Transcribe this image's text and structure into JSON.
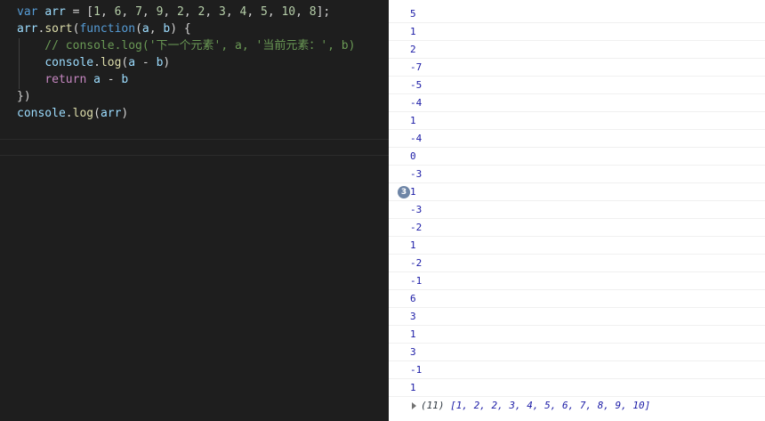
{
  "editor": {
    "lines": [
      [
        {
          "t": "var",
          "c": "kw"
        },
        {
          "t": " ",
          "c": "plain"
        },
        {
          "t": "arr",
          "c": "var"
        },
        {
          "t": " = [",
          "c": "plain"
        },
        {
          "t": "1",
          "c": "num"
        },
        {
          "t": ", ",
          "c": "plain"
        },
        {
          "t": "6",
          "c": "num"
        },
        {
          "t": ", ",
          "c": "plain"
        },
        {
          "t": "7",
          "c": "num"
        },
        {
          "t": ", ",
          "c": "plain"
        },
        {
          "t": "9",
          "c": "num"
        },
        {
          "t": ", ",
          "c": "plain"
        },
        {
          "t": "2",
          "c": "num"
        },
        {
          "t": ", ",
          "c": "plain"
        },
        {
          "t": "2",
          "c": "num"
        },
        {
          "t": ", ",
          "c": "plain"
        },
        {
          "t": "3",
          "c": "num"
        },
        {
          "t": ", ",
          "c": "plain"
        },
        {
          "t": "4",
          "c": "num"
        },
        {
          "t": ", ",
          "c": "plain"
        },
        {
          "t": "5",
          "c": "num"
        },
        {
          "t": ", ",
          "c": "plain"
        },
        {
          "t": "10",
          "c": "num"
        },
        {
          "t": ", ",
          "c": "plain"
        },
        {
          "t": "8",
          "c": "num"
        },
        {
          "t": "];",
          "c": "plain"
        }
      ],
      [
        {
          "t": "arr",
          "c": "var"
        },
        {
          "t": ".",
          "c": "plain"
        },
        {
          "t": "sort",
          "c": "fn"
        },
        {
          "t": "(",
          "c": "plain"
        },
        {
          "t": "function",
          "c": "kw"
        },
        {
          "t": "(",
          "c": "plain"
        },
        {
          "t": "a",
          "c": "var"
        },
        {
          "t": ", ",
          "c": "plain"
        },
        {
          "t": "b",
          "c": "var"
        },
        {
          "t": ") {",
          "c": "plain"
        }
      ],
      [
        {
          "t": "    // console.log('下一个元素', a, '当前元素：', b)",
          "c": "cmt"
        }
      ],
      [
        {
          "t": "    ",
          "c": "plain"
        },
        {
          "t": "console",
          "c": "var"
        },
        {
          "t": ".",
          "c": "plain"
        },
        {
          "t": "log",
          "c": "fn"
        },
        {
          "t": "(",
          "c": "plain"
        },
        {
          "t": "a",
          "c": "var"
        },
        {
          "t": " - ",
          "c": "plain"
        },
        {
          "t": "b",
          "c": "var"
        },
        {
          "t": ")",
          "c": "plain"
        }
      ],
      [
        {
          "t": "    ",
          "c": "plain"
        },
        {
          "t": "return",
          "c": "ctrl"
        },
        {
          "t": " ",
          "c": "plain"
        },
        {
          "t": "a",
          "c": "var"
        },
        {
          "t": " - ",
          "c": "plain"
        },
        {
          "t": "b",
          "c": "var"
        }
      ],
      [
        {
          "t": "})",
          "c": "plain"
        }
      ],
      [
        {
          "t": "console",
          "c": "var"
        },
        {
          "t": ".",
          "c": "plain"
        },
        {
          "t": "log",
          "c": "fn"
        },
        {
          "t": "(",
          "c": "plain"
        },
        {
          "t": "arr",
          "c": "var"
        },
        {
          "t": ")",
          "c": "plain"
        }
      ]
    ]
  },
  "console": {
    "entries": [
      {
        "value": "5"
      },
      {
        "value": "1"
      },
      {
        "value": "2"
      },
      {
        "value": "-7"
      },
      {
        "value": "-5"
      },
      {
        "value": "-4"
      },
      {
        "value": "1"
      },
      {
        "value": "-4"
      },
      {
        "value": "0"
      },
      {
        "value": "-3"
      },
      {
        "value": "1",
        "badge": "3"
      },
      {
        "value": "-3"
      },
      {
        "value": "-2"
      },
      {
        "value": "1"
      },
      {
        "value": "-2"
      },
      {
        "value": "-1"
      },
      {
        "value": "6"
      },
      {
        "value": "3"
      },
      {
        "value": "1"
      },
      {
        "value": "3"
      },
      {
        "value": "-1"
      },
      {
        "value": "1"
      }
    ],
    "array_count": "(11)",
    "array_values": "[1, 2, 2, 3, 4, 5, 6, 7, 8, 9, 10]"
  },
  "colors": {
    "keyword": "#569cd6",
    "control": "#c586c0",
    "variable": "#9cdcfe",
    "number": "#b5cea8",
    "function": "#dcdcaa",
    "comment": "#6a9955",
    "console_number": "#1a1aa6"
  }
}
